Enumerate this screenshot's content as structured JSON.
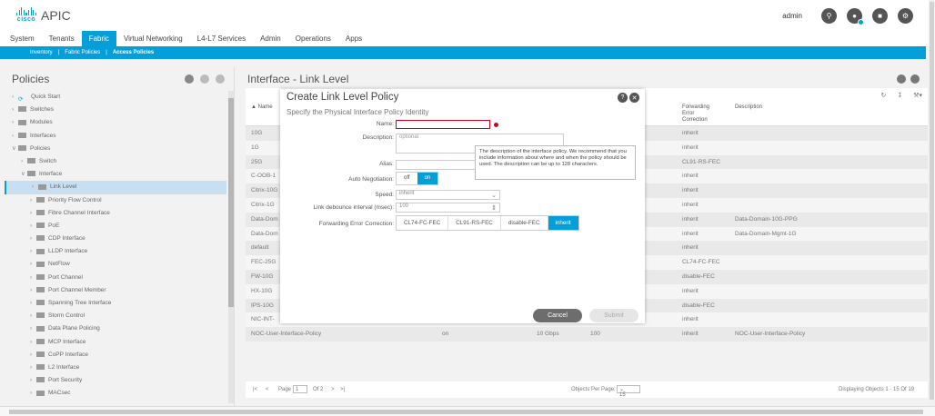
{
  "header": {
    "logo_text": "cisco",
    "app_title": "APIC",
    "user": "admin",
    "icons": [
      "search-icon",
      "notification-icon",
      "feedback-icon",
      "settings-icon"
    ]
  },
  "mainnav": {
    "tabs": [
      "System",
      "Tenants",
      "Fabric",
      "Virtual Networking",
      "L4-L7 Services",
      "Admin",
      "Operations",
      "Apps"
    ],
    "active": "Fabric"
  },
  "subnav": {
    "items": [
      "Inventory",
      "Fabric Policies",
      "Access Policies"
    ],
    "active": "Access Policies"
  },
  "left": {
    "title": "Policies",
    "tree": [
      {
        "label": "Quick Start",
        "depth": 0
      },
      {
        "label": "Switches",
        "depth": 0
      },
      {
        "label": "Modules",
        "depth": 0
      },
      {
        "label": "Interfaces",
        "depth": 0
      },
      {
        "label": "Policies",
        "depth": 0
      },
      {
        "label": "Switch",
        "depth": 1
      },
      {
        "label": "Interface",
        "depth": 1
      },
      {
        "label": "Link Level",
        "depth": 2,
        "selected": true
      },
      {
        "label": "Priority Flow Control",
        "depth": 2
      },
      {
        "label": "Fibre Channel Interface",
        "depth": 2
      },
      {
        "label": "PoE",
        "depth": 2
      },
      {
        "label": "CDP Interface",
        "depth": 2
      },
      {
        "label": "LLDP Interface",
        "depth": 2
      },
      {
        "label": "NetFlow",
        "depth": 2
      },
      {
        "label": "Port Channel",
        "depth": 2
      },
      {
        "label": "Port Channel Member",
        "depth": 2
      },
      {
        "label": "Spanning Tree Interface",
        "depth": 2
      },
      {
        "label": "Storm Control",
        "depth": 2
      },
      {
        "label": "Data Plane Policing",
        "depth": 2
      },
      {
        "label": "MCP Interface",
        "depth": 2
      },
      {
        "label": "CoPP Interface",
        "depth": 2
      },
      {
        "label": "L2 Interface",
        "depth": 2
      },
      {
        "label": "Port Security",
        "depth": 2
      },
      {
        "label": "MACsec",
        "depth": 2
      }
    ]
  },
  "right": {
    "title": "Interface - Link Level",
    "columns": {
      "name": "Name",
      "fec": "Forwarding Error Correction",
      "desc": "Description"
    },
    "rows": [
      {
        "name": "10G",
        "auto": "",
        "speed": "",
        "debounce": "",
        "fec": "inherit",
        "desc": ""
      },
      {
        "name": "1G",
        "auto": "",
        "speed": "",
        "debounce": "",
        "fec": "inherit",
        "desc": ""
      },
      {
        "name": "25G",
        "auto": "",
        "speed": "",
        "debounce": "",
        "fec": "CL91-RS-FEC",
        "desc": ""
      },
      {
        "name": "C-OOB-1",
        "auto": "",
        "speed": "",
        "debounce": "",
        "fec": "inherit",
        "desc": ""
      },
      {
        "name": "Citrix-10G",
        "auto": "",
        "speed": "",
        "debounce": "",
        "fec": "inherit",
        "desc": ""
      },
      {
        "name": "Citrix-1G",
        "auto": "",
        "speed": "",
        "debounce": "",
        "fec": "inherit",
        "desc": ""
      },
      {
        "name": "Data-Dom",
        "auto": "",
        "speed": "",
        "debounce": "",
        "fec": "inherit",
        "desc": "Data-Domain-10G-PPG"
      },
      {
        "name": "Data-Dom",
        "auto": "",
        "speed": "",
        "debounce": "",
        "fec": "inherit",
        "desc": "Data-Domain-Mgmt-1G"
      },
      {
        "name": "default",
        "auto": "",
        "speed": "",
        "debounce": "",
        "fec": "inherit",
        "desc": ""
      },
      {
        "name": "FEC-25G",
        "auto": "",
        "speed": "",
        "debounce": "",
        "fec": "CL74-FC-FEC",
        "desc": ""
      },
      {
        "name": "FW-10G",
        "auto": "",
        "speed": "",
        "debounce": "",
        "fec": "disable-FEC",
        "desc": ""
      },
      {
        "name": "HX-10G",
        "auto": "",
        "speed": "",
        "debounce": "",
        "fec": "inherit",
        "desc": ""
      },
      {
        "name": "IPS-10G",
        "auto": "",
        "speed": "",
        "debounce": "",
        "fec": "disable-FEC",
        "desc": ""
      },
      {
        "name": "NIC-INT-",
        "auto": "",
        "speed": "",
        "debounce": "",
        "fec": "inherit",
        "desc": ""
      },
      {
        "name": "NOC-User-Interface-Policy",
        "auto": "on",
        "speed": "10 Gbps",
        "debounce": "100",
        "fec": "inherit",
        "desc": "NOC-User-Interface-Policy"
      }
    ],
    "pager": {
      "page_label": "Page",
      "page": "1",
      "of": "Of 2",
      "per_page_label": "Objects Per Page:",
      "per_page": "15",
      "displaying": "Displaying Objects 1 - 15 Of 19"
    }
  },
  "modal": {
    "title": "Create Link Level Policy",
    "subtitle": "Specify the Physical Interface Policy Identity",
    "name_label": "Name:",
    "name_value": "",
    "desc_label": "Description:",
    "desc_placeholder": "optional",
    "alias_label": "Alias:",
    "alias_value": "",
    "autoneg_label": "Auto Negotiation:",
    "autoneg_options": [
      "off",
      "on"
    ],
    "autoneg_selected": "on",
    "speed_label": "Speed:",
    "speed_value": "inherit",
    "debounce_label": "Link debounce interval (msec):",
    "debounce_value": "100",
    "fec_label": "Forwarding Error Correction:",
    "fec_options": [
      "CL74-FC-FEC",
      "CL91-RS-FEC",
      "disable-FEC",
      "inherit"
    ],
    "fec_selected": "inherit",
    "tooltip": "The description of the interface policy. We recommend that you include information about where and when the policy should be used. The description can be up to 128 characters.",
    "cancel": "Cancel",
    "submit": "Submit"
  },
  "colors": {
    "accent": "#049fd9",
    "error": "#d0021b"
  }
}
